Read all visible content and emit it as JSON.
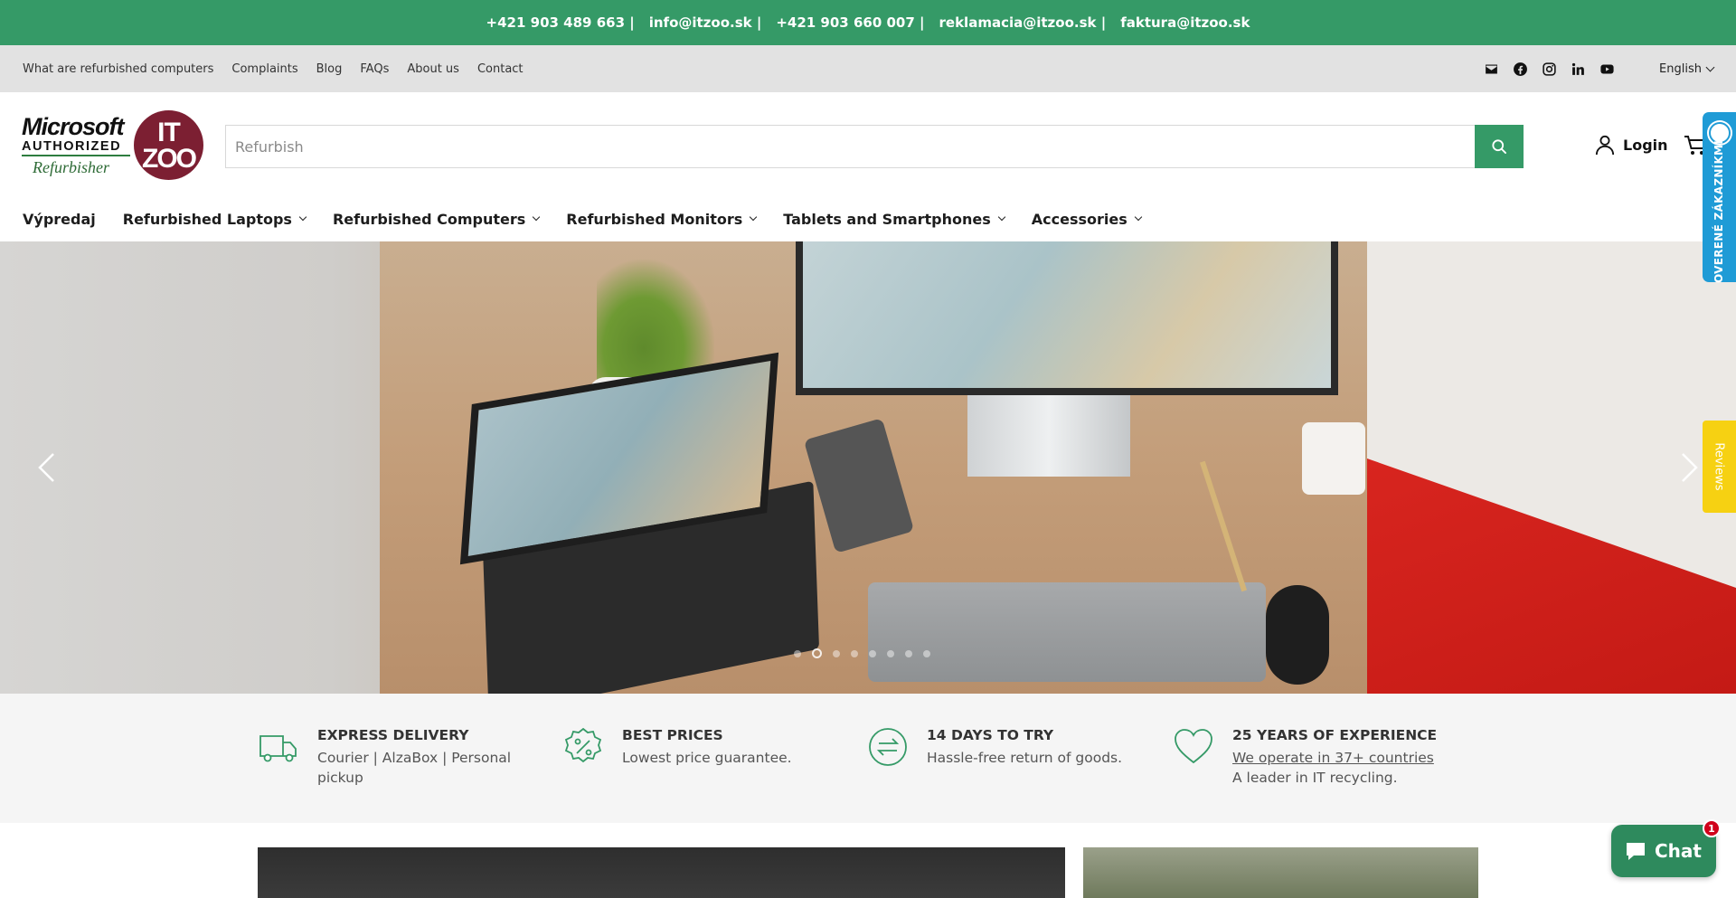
{
  "topbar": {
    "contacts": [
      "+421 903 489 663 |",
      "info@itzoo.sk |",
      "+421 903 660 007 |",
      "reklamacia@itzoo.sk |",
      "faktura@itzoo.sk"
    ]
  },
  "utility_nav": {
    "links": [
      "What are refurbished computers",
      "Complaints",
      "Blog",
      "FAQs",
      "About us",
      "Contact"
    ],
    "social_icons": [
      "email-icon",
      "facebook-icon",
      "instagram-icon",
      "linkedin-icon",
      "youtube-icon"
    ],
    "language": "English"
  },
  "logo": {
    "ms_line1": "Microsoft",
    "ms_line2": "AUTHORIZED",
    "ms_line3": "Refurbisher",
    "it_line1": "IT",
    "it_line2": "ZOO"
  },
  "search": {
    "placeholder": "Refurbish",
    "value": ""
  },
  "account": {
    "login_label": "Login"
  },
  "main_nav": {
    "items": [
      {
        "label": "Výpredaj",
        "dropdown": false
      },
      {
        "label": "Refurbished Laptops",
        "dropdown": true
      },
      {
        "label": "Refurbished Computers",
        "dropdown": true
      },
      {
        "label": "Refurbished Monitors",
        "dropdown": true
      },
      {
        "label": "Tablets and Smartphones",
        "dropdown": true
      },
      {
        "label": "Accessories",
        "dropdown": true
      }
    ]
  },
  "hero": {
    "slide_count": 8,
    "active_slide": 2
  },
  "features": [
    {
      "title": "EXPRESS DELIVERY",
      "desc": "Courier | AlzaBox | Personal pickup",
      "icon": "truck-icon"
    },
    {
      "title": "BEST PRICES",
      "desc": "Lowest price guarantee.",
      "icon": "percent-badge-icon"
    },
    {
      "title": "14 DAYS TO TRY",
      "desc": "Hassle-free return of goods.",
      "icon": "exchange-arrows-icon"
    },
    {
      "title": "25 YEARS OF EXPERIENCE",
      "link": "We operate in 37+ countries",
      "desc": "A leader in IT recycling.",
      "icon": "heart-icon"
    }
  ],
  "side_badges": {
    "verified": "OVERENÉ ZÁKAZNÍKMI",
    "reviews": "Reviews"
  },
  "chat": {
    "label": "Chat",
    "unread": "1"
  },
  "colors": {
    "brand_green": "#359a67",
    "utility_bg": "#e2e2e2",
    "verified_blue": "#1f9bd6",
    "reviews_yellow": "#f6d112"
  }
}
